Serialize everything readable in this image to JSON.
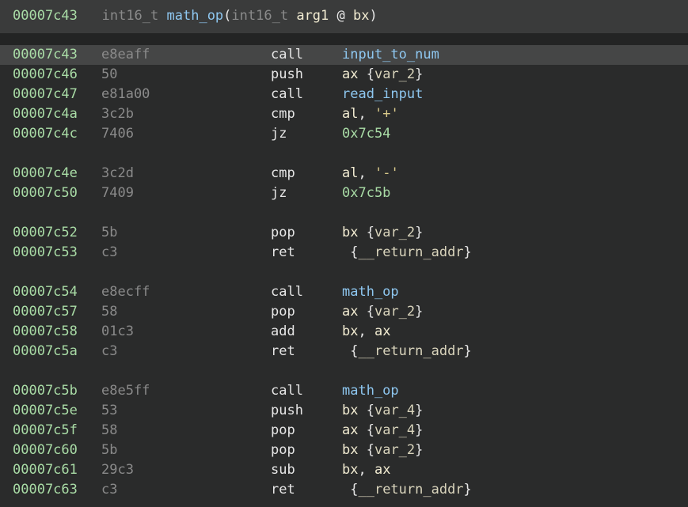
{
  "header": {
    "address": "00007c43",
    "return_type": "int16_t",
    "func_name": "math_op",
    "paren_open": "(",
    "arg_type": "int16_t",
    "arg_name": "arg1",
    "at": "@",
    "arg_reg": "bx",
    "paren_close": ")"
  },
  "rows": [
    {
      "addr": "00007c43",
      "bytes": "e8eaff",
      "mn": "call",
      "ops": [
        {
          "t": "input_to_num",
          "k": "func"
        }
      ],
      "highlight": true
    },
    {
      "addr": "00007c46",
      "bytes": "50",
      "mn": "push",
      "ops": [
        {
          "t": "ax",
          "k": "reg"
        },
        {
          "t": " {",
          "k": "plain"
        },
        {
          "t": "var_2",
          "k": "var"
        },
        {
          "t": "}",
          "k": "plain"
        }
      ]
    },
    {
      "addr": "00007c47",
      "bytes": "e81a00",
      "mn": "call",
      "ops": [
        {
          "t": "read_input",
          "k": "func"
        }
      ]
    },
    {
      "addr": "00007c4a",
      "bytes": "3c2b",
      "mn": "cmp",
      "ops": [
        {
          "t": "al",
          "k": "reg"
        },
        {
          "t": ", ",
          "k": "plain"
        },
        {
          "t": "'+'",
          "k": "str"
        }
      ]
    },
    {
      "addr": "00007c4c",
      "bytes": "7406",
      "mn": "jz",
      "ops": [
        {
          "t": "0x7c54",
          "k": "num"
        }
      ]
    },
    {
      "blank": true
    },
    {
      "addr": "00007c4e",
      "bytes": "3c2d",
      "mn": "cmp",
      "ops": [
        {
          "t": "al",
          "k": "reg"
        },
        {
          "t": ", ",
          "k": "plain"
        },
        {
          "t": "'-'",
          "k": "str"
        }
      ]
    },
    {
      "addr": "00007c50",
      "bytes": "7409",
      "mn": "jz",
      "ops": [
        {
          "t": "0x7c5b",
          "k": "num"
        }
      ]
    },
    {
      "blank": true
    },
    {
      "addr": "00007c52",
      "bytes": "5b",
      "mn": "pop",
      "ops": [
        {
          "t": "bx",
          "k": "reg"
        },
        {
          "t": " {",
          "k": "plain"
        },
        {
          "t": "var_2",
          "k": "var"
        },
        {
          "t": "}",
          "k": "plain"
        }
      ]
    },
    {
      "addr": "00007c53",
      "bytes": "c3",
      "mn": "ret",
      "ops": [
        {
          "t": " {",
          "k": "plain"
        },
        {
          "t": "__return_addr",
          "k": "var"
        },
        {
          "t": "}",
          "k": "plain"
        }
      ]
    },
    {
      "blank": true
    },
    {
      "addr": "00007c54",
      "bytes": "e8ecff",
      "mn": "call",
      "ops": [
        {
          "t": "math_op",
          "k": "func"
        }
      ]
    },
    {
      "addr": "00007c57",
      "bytes": "58",
      "mn": "pop",
      "ops": [
        {
          "t": "ax",
          "k": "reg"
        },
        {
          "t": " {",
          "k": "plain"
        },
        {
          "t": "var_2",
          "k": "var"
        },
        {
          "t": "}",
          "k": "plain"
        }
      ]
    },
    {
      "addr": "00007c58",
      "bytes": "01c3",
      "mn": "add",
      "ops": [
        {
          "t": "bx",
          "k": "reg"
        },
        {
          "t": ", ",
          "k": "plain"
        },
        {
          "t": "ax",
          "k": "reg"
        }
      ]
    },
    {
      "addr": "00007c5a",
      "bytes": "c3",
      "mn": "ret",
      "ops": [
        {
          "t": " {",
          "k": "plain"
        },
        {
          "t": "__return_addr",
          "k": "var"
        },
        {
          "t": "}",
          "k": "plain"
        }
      ]
    },
    {
      "blank": true
    },
    {
      "addr": "00007c5b",
      "bytes": "e8e5ff",
      "mn": "call",
      "ops": [
        {
          "t": "math_op",
          "k": "func"
        }
      ]
    },
    {
      "addr": "00007c5e",
      "bytes": "53",
      "mn": "push",
      "ops": [
        {
          "t": "bx",
          "k": "reg"
        },
        {
          "t": " {",
          "k": "plain"
        },
        {
          "t": "var_4",
          "k": "var"
        },
        {
          "t": "}",
          "k": "plain"
        }
      ]
    },
    {
      "addr": "00007c5f",
      "bytes": "58",
      "mn": "pop",
      "ops": [
        {
          "t": "ax",
          "k": "reg"
        },
        {
          "t": " {",
          "k": "plain"
        },
        {
          "t": "var_4",
          "k": "var"
        },
        {
          "t": "}",
          "k": "plain"
        }
      ]
    },
    {
      "addr": "00007c60",
      "bytes": "5b",
      "mn": "pop",
      "ops": [
        {
          "t": "bx",
          "k": "reg"
        },
        {
          "t": " {",
          "k": "plain"
        },
        {
          "t": "var_2",
          "k": "var"
        },
        {
          "t": "}",
          "k": "plain"
        }
      ]
    },
    {
      "addr": "00007c61",
      "bytes": "29c3",
      "mn": "sub",
      "ops": [
        {
          "t": "bx",
          "k": "reg"
        },
        {
          "t": ", ",
          "k": "plain"
        },
        {
          "t": "ax",
          "k": "reg"
        }
      ]
    },
    {
      "addr": "00007c63",
      "bytes": "c3",
      "mn": "ret",
      "ops": [
        {
          "t": " {",
          "k": "plain"
        },
        {
          "t": "__return_addr",
          "k": "var"
        },
        {
          "t": "}",
          "k": "plain"
        }
      ]
    }
  ]
}
